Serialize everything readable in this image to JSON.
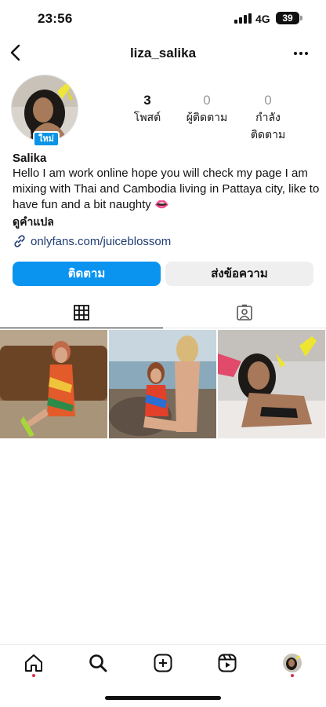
{
  "status_bar": {
    "time": "23:56",
    "network": "4G",
    "battery": "39"
  },
  "nav": {
    "username": "liza_salika",
    "back_icon": "chevron-left-icon",
    "more_icon": "more-horizontal-icon"
  },
  "profile": {
    "new_badge": "ใหม่",
    "stats": {
      "posts_count": "3",
      "posts_label": "โพสต์",
      "followers_count": "0",
      "followers_label": "ผู้ติดตาม",
      "following_count": "0",
      "following_label": "กำลังติดตาม"
    },
    "name": "Salika",
    "bio": "Hello I am work online hope you will check my page I am mixing with Thai and Cambodia living in Pattaya city, like to have fun and a bit naughty 👄",
    "translate_label": "ดูคำแปล",
    "link": "onlyfans.com/juiceblossom"
  },
  "buttons": {
    "follow": "ติดตาม",
    "message": "ส่งข้อความ"
  },
  "tabs": [
    {
      "name": "grid",
      "icon": "grid-icon",
      "active": true
    },
    {
      "name": "tagged",
      "icon": "tagged-person-icon",
      "active": false
    }
  ],
  "bottom_nav": [
    {
      "name": "home",
      "icon": "home-icon",
      "dot": true
    },
    {
      "name": "search",
      "icon": "search-icon",
      "dot": false
    },
    {
      "name": "create",
      "icon": "plus-square-icon",
      "dot": false
    },
    {
      "name": "reels",
      "icon": "reels-icon",
      "dot": false
    },
    {
      "name": "profile",
      "icon": "avatar-icon",
      "dot": true
    }
  ],
  "colors": {
    "accent": "#0a94f0",
    "badge": "#0a94e6",
    "link": "#1e3c72",
    "notification_dot": "#e02b46"
  }
}
